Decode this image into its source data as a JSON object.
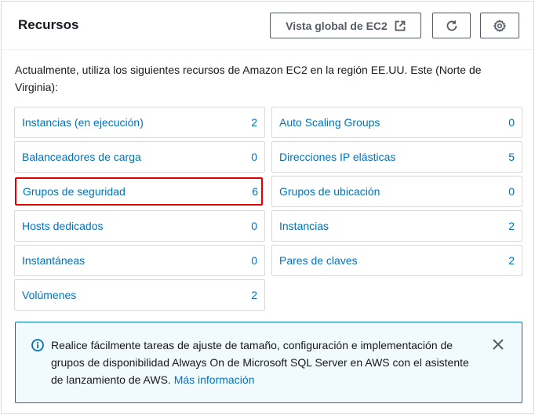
{
  "header": {
    "title": "Recursos",
    "global_view_label": "Vista global de EC2"
  },
  "description": "Actualmente, utiliza los siguientes recursos de Amazon EC2 en la región EE.UU. Este (Norte de Virginia):",
  "resources": [
    {
      "label": "Instancias (en ejecución)",
      "count": "2"
    },
    {
      "label": "Auto Scaling Groups",
      "count": "0"
    },
    {
      "label": "Balanceadores de carga",
      "count": "0"
    },
    {
      "label": "Direcciones IP elásticas",
      "count": "5"
    },
    {
      "label": "Grupos de seguridad",
      "count": "6"
    },
    {
      "label": "Grupos de ubicación",
      "count": "0"
    },
    {
      "label": "Hosts dedicados",
      "count": "0"
    },
    {
      "label": "Instancias",
      "count": "2"
    },
    {
      "label": "Instantáneas",
      "count": "0"
    },
    {
      "label": "Pares de claves",
      "count": "2"
    },
    {
      "label": "Volúmenes",
      "count": "2"
    }
  ],
  "info": {
    "text": "Realice fácilmente tareas de ajuste de tamaño, configuración e implementación de grupos de disponibilidad Always On de Microsoft SQL Server en AWS con el asistente de lanzamiento de AWS.",
    "link": "Más información"
  },
  "colors": {
    "link": "#0073bb",
    "highlight_border": "#e00000",
    "info_bg": "#f1faff"
  },
  "icons": {
    "external": "external-link-icon",
    "refresh": "refresh-icon",
    "settings": "gear-icon",
    "info": "info-icon",
    "close": "close-icon"
  }
}
